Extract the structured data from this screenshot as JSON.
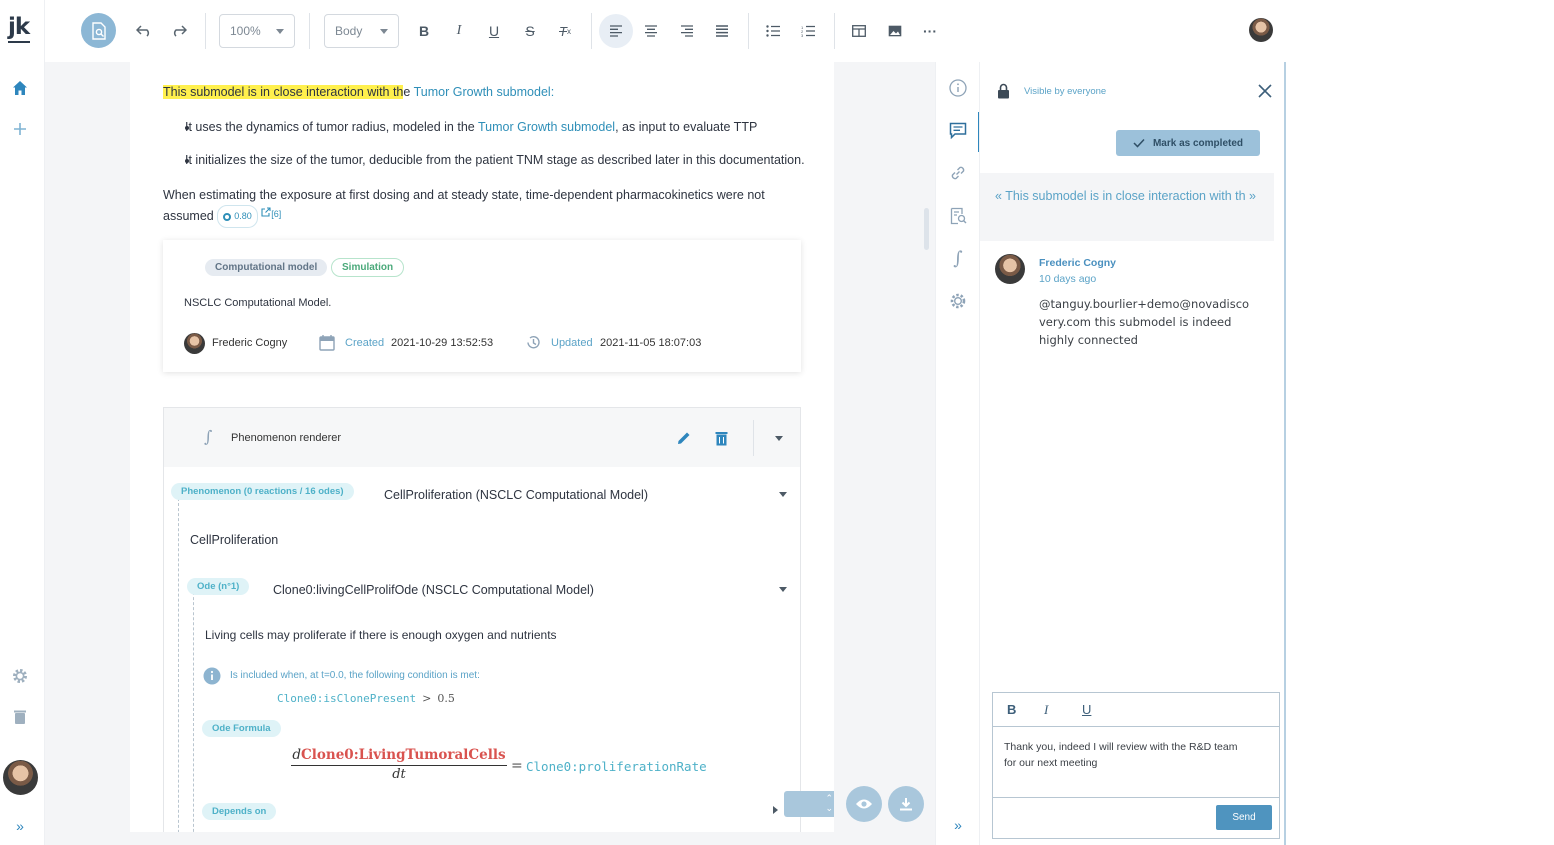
{
  "app": {
    "logo": "jk"
  },
  "toolbar": {
    "zoom": "100%",
    "style": "Body"
  },
  "doc": {
    "intro_highlight": "This submodel is in close interaction with th",
    "intro_rest": "e ",
    "intro_link": "Tumor Growth submodel",
    "intro_end": ":",
    "bullet1_pre": "It uses the dynamics of tumor radius, modeled in the ",
    "bullet1_link": "Tumor Growth submodel",
    "bullet1_post": ", as input to evaluate TTP",
    "bullet2": "It initializes the size of the tumor, deducible from the patient TNM stage as described later in this documentation.",
    "para2_line1": "When estimating the exposure at first dosing and at steady state, time-dependent pharmacokinetics were not",
    "para2_line2": "assumed",
    "score": "0.80",
    "ref": "[6]"
  },
  "model_card": {
    "tag1": "Computational model",
    "tag2": "Simulation",
    "name": "NSCLC Computational Model.",
    "author": "Frederic Cogny",
    "created_label": "Created",
    "created": "2021-10-29 13:52:53",
    "updated_label": "Updated",
    "updated": "2021-11-05 18:07:03"
  },
  "renderer": {
    "title": "Phenomenon renderer",
    "phenomenon_pill": "Phenomenon (0 reactions / 16 odes)",
    "phenomenon_title": "CellProliferation (NSCLC Computational Model)",
    "phenomenon_name": "CellProliferation",
    "ode_pill": "Ode (n°1)",
    "ode_title": "Clone0:livingCellProlifOde (NSCLC Computational Model)",
    "ode_desc": "Living cells may proliferate if there is enough oxygen and nutrients",
    "condition_label": "Is included when, at t=0.0, the following condition is met:",
    "condition_var": "Clone0:isClonePresent",
    "condition_op": ">",
    "condition_val": "0.5",
    "formula_pill": "Ode Formula",
    "formula_d": "d",
    "formula_num": "Clone0:LivingTumoralCells",
    "formula_den": "dt",
    "formula_eq": "=",
    "formula_rhs": "Clone0:proliferationRate",
    "depends_pill": "Depends on"
  },
  "comments": {
    "visibility": "Visible by everyone",
    "mark_completed": "Mark as completed",
    "quote": "« This submodel is in close interaction with th »",
    "author": "Frederic Cogny",
    "time": "10 days ago",
    "text_line1": "@tanguy.bourlier+demo@novadisco",
    "text_line2": "very.com this submodel is indeed",
    "text_line3": "highly connected",
    "reply_line1": "Thank you, indeed I will review with the R&D team",
    "reply_line2": "for our next meeting",
    "send": "Send",
    "fmt_bold": "B",
    "fmt_italic": "I",
    "fmt_underline": "U"
  },
  "colors": {
    "accent": "#2f8fb8",
    "highlight": "#fff04d",
    "formula_red": "#d9534f",
    "formula_teal": "#4eb1c8",
    "send": "#4f94bf"
  }
}
